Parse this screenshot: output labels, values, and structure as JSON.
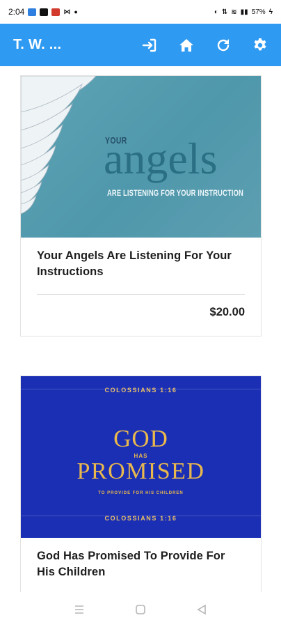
{
  "status_bar": {
    "time": "2:04",
    "battery": "57%"
  },
  "app_bar": {
    "title": "T. W. ...",
    "icons": [
      "login-icon",
      "home-icon",
      "refresh-icon",
      "settings-icon"
    ]
  },
  "products": [
    {
      "image_text": {
        "top": "YOUR",
        "main": "angels",
        "sub": "ARE LISTENING FOR YOUR INSTRUCTION"
      },
      "title": "Your Angels Are Listening For Your Instructions",
      "price": "$20.00"
    },
    {
      "image_text": {
        "ref": "COLOSSIANS 1:16",
        "line1": "GOD",
        "has": "HAS",
        "line2": "PROMISED",
        "sub": "TO PROVIDE FOR HIS CHILDREN"
      },
      "title": "God Has Promised To Provide For His Children"
    }
  ],
  "colors": {
    "app_bar": "#2f9af1",
    "angels_bg": "#5fa4b6",
    "god_bg": "#1b2fb4",
    "god_gold": "#e9b84d"
  }
}
